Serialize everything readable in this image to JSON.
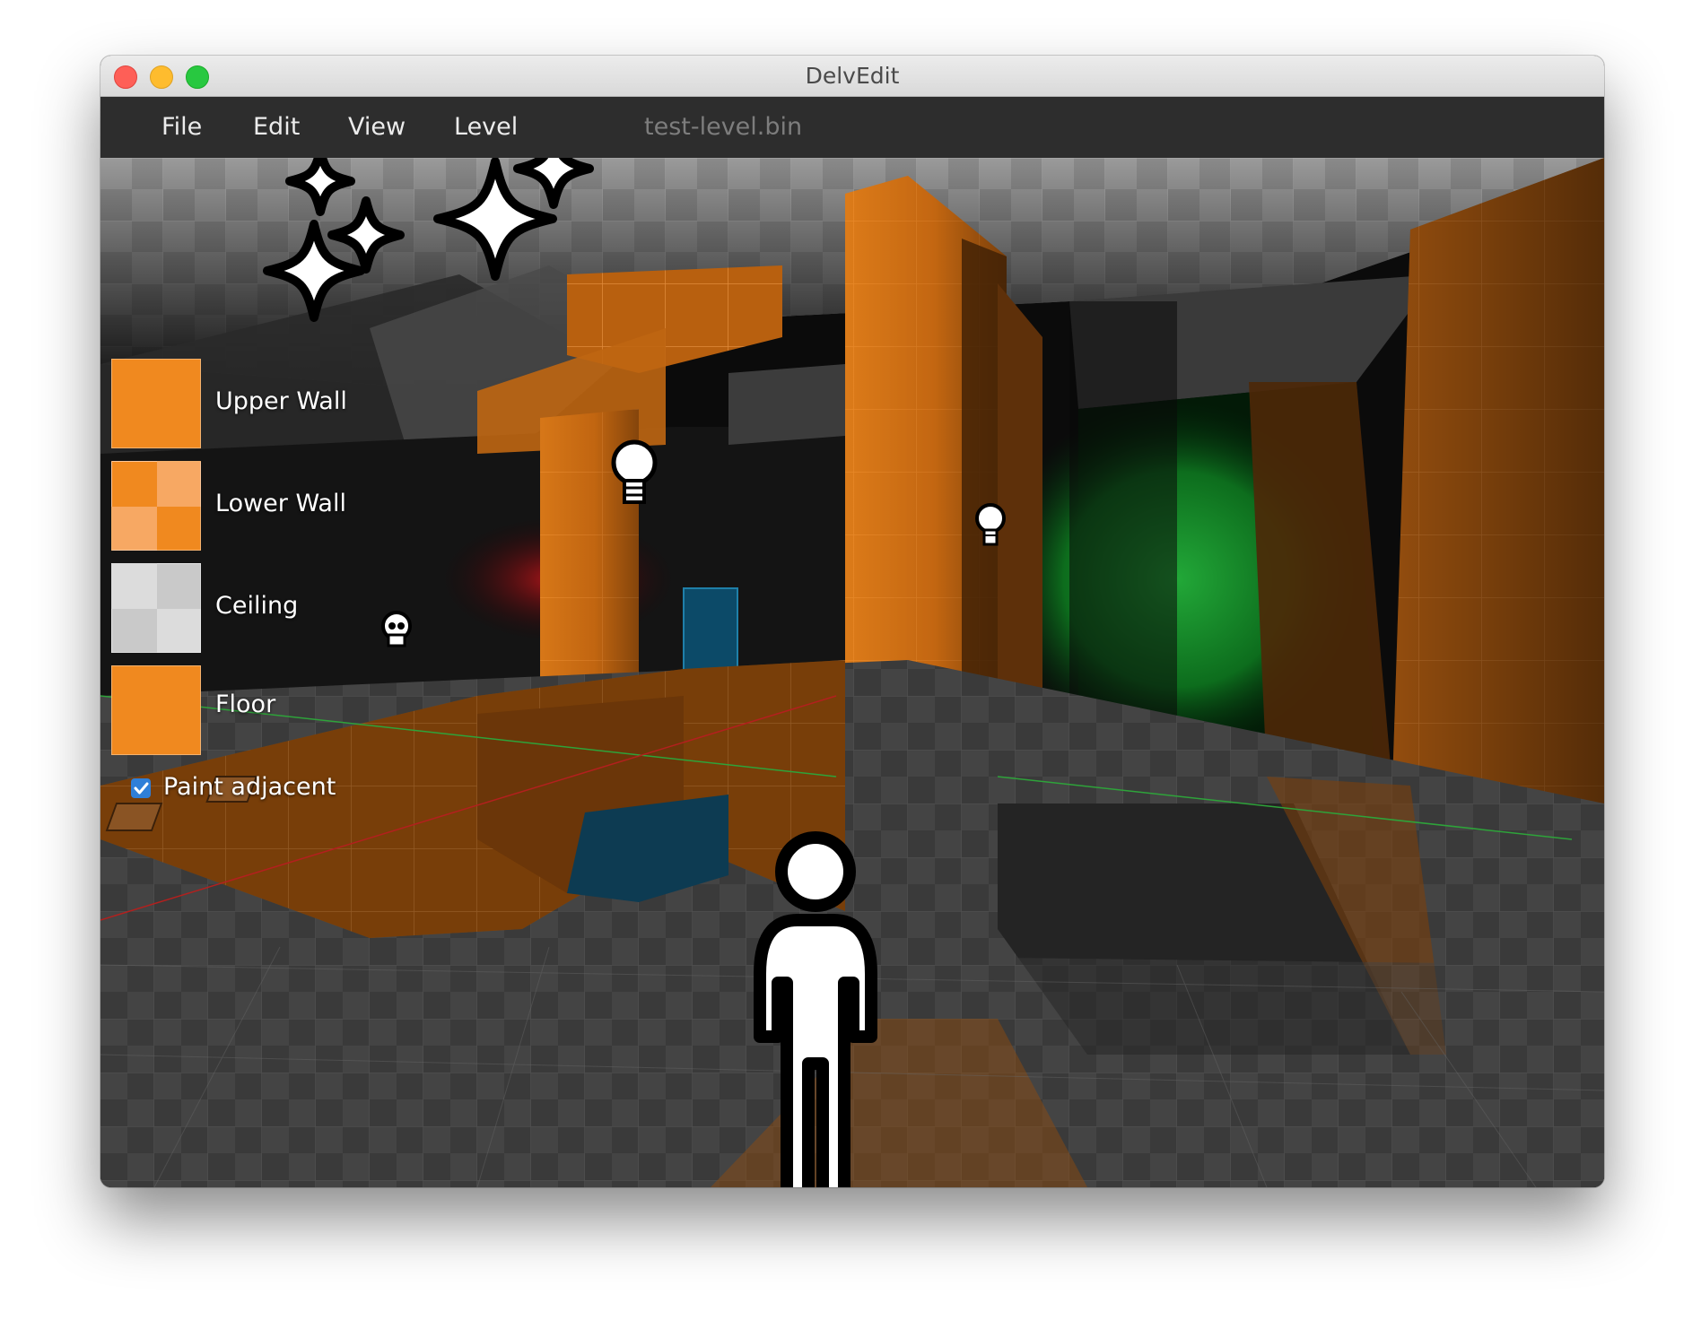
{
  "window": {
    "title": "DelvEdit"
  },
  "menu": {
    "file": "File",
    "edit": "Edit",
    "view": "View",
    "level": "Level",
    "filename": "test-level.bin"
  },
  "palette": {
    "upper_wall": {
      "label": "Upper Wall",
      "color": "#f0891f"
    },
    "lower_wall": {
      "label": "Lower Wall",
      "color": "#f0891f",
      "alt_color": "#f7a863"
    },
    "ceiling": {
      "label": "Ceiling",
      "color": "#c9c9c9",
      "alt_color": "#dcdcdc"
    },
    "floor": {
      "label": "Floor",
      "color": "#f0891f"
    }
  },
  "paint_adjacent": {
    "label": "Paint adjacent",
    "checked": true
  },
  "icons": {
    "ceiling_markers": "sparkle-icon",
    "lights": "lightbulb-icon",
    "monster": "skull-icon",
    "player": "player-icon"
  }
}
